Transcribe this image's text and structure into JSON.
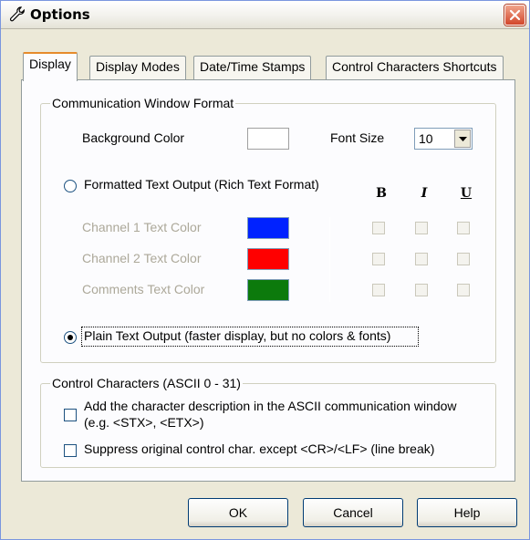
{
  "window": {
    "title": "Options"
  },
  "tabs": [
    "Display",
    "Display Modes",
    "Date/Time Stamps",
    "Control Characters Shortcuts"
  ],
  "communication_group": {
    "title": "Communication Window Format",
    "background_color_label": "Background Color",
    "background_color": "#ffffff",
    "font_size_label": "Font Size",
    "font_size_value": "10",
    "formatted_output_label": "Formatted Text Output (Rich Text Format)",
    "formatted_output_selected": false,
    "format_headers": {
      "bold": "B",
      "italic": "I",
      "underline": "U"
    },
    "rows": [
      {
        "label": "Channel 1 Text Color",
        "color": "#0022ff"
      },
      {
        "label": "Channel 2 Text Color",
        "color": "#ff0000"
      },
      {
        "label": "Comments Text Color",
        "color": "#0c7a0c"
      }
    ],
    "plain_output_label": "Plain Text Output (faster display, but no colors & fonts)",
    "plain_output_selected": true
  },
  "control_group": {
    "title": "Control Characters (ASCII 0 - 31)",
    "option1_line1": "Add the character description in the ASCII communication window",
    "option1_line2": "(e.g. <STX>, <ETX>)",
    "option2": "Suppress original control char. except <CR>/<LF> (line break)"
  },
  "buttons": {
    "ok": "OK",
    "cancel": "Cancel",
    "help": "Help"
  },
  "icons": {
    "title": "wrench-icon",
    "close": "close-icon",
    "dropdown": "chevron-down-icon"
  }
}
